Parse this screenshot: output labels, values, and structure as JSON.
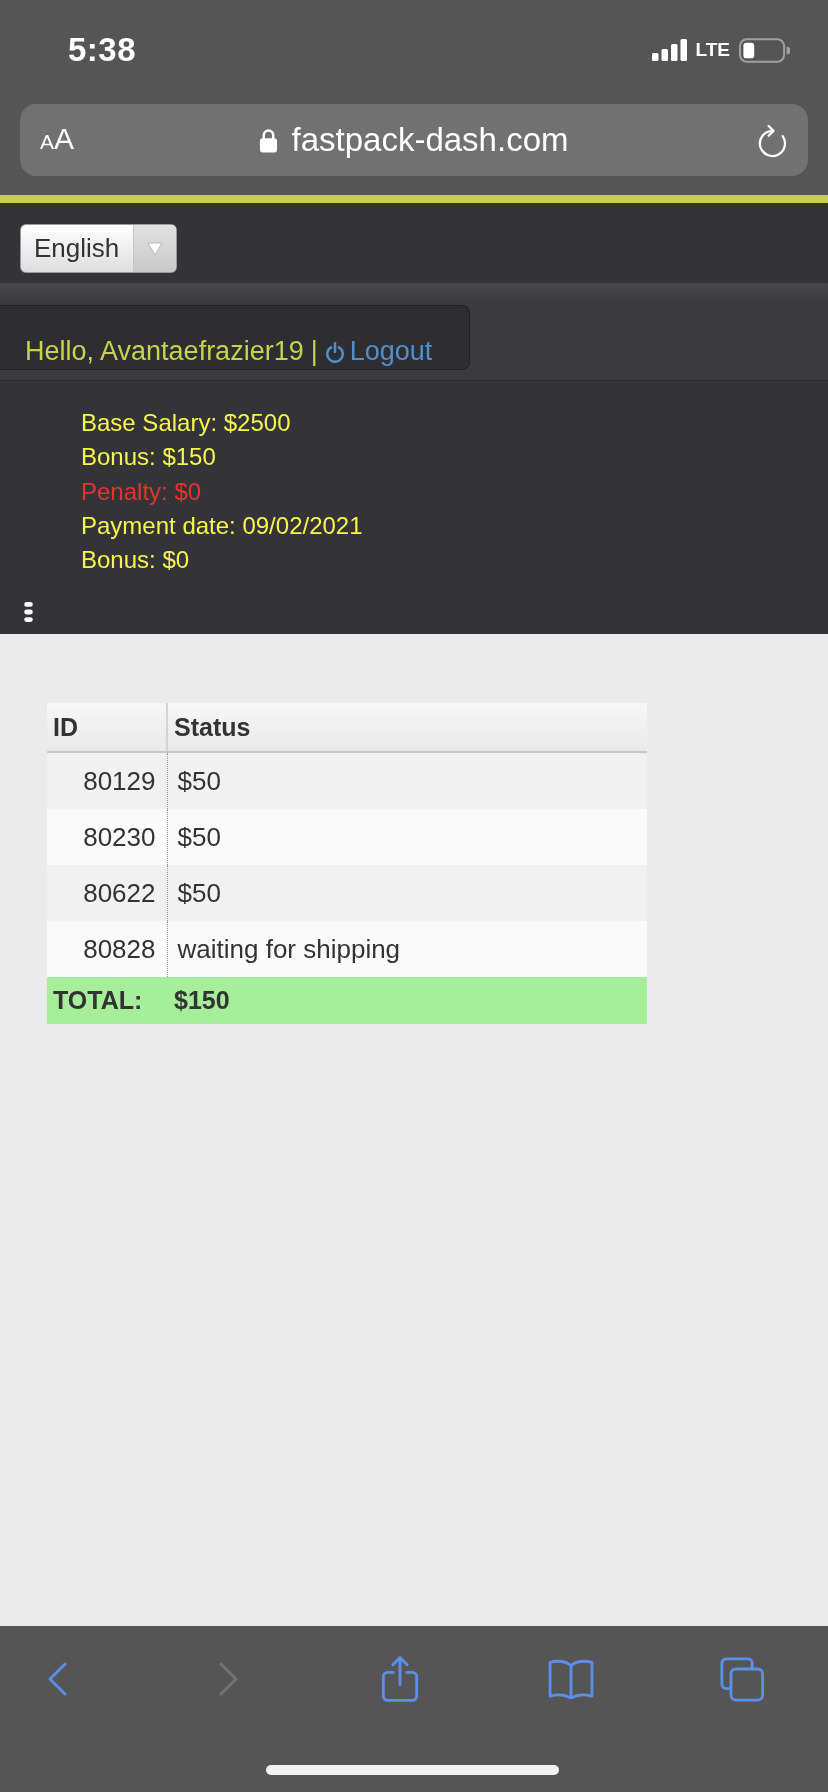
{
  "status_bar": {
    "time": "5:38",
    "network": "LTE"
  },
  "address_bar": {
    "reader_button": "AA",
    "url": "fastpack-dash.com",
    "secure": true
  },
  "language_select": {
    "value": "English"
  },
  "user_bar": {
    "greeting": "Hello, Avantaefrazier19",
    "separator": "|",
    "logout": "Logout"
  },
  "summary": [
    {
      "text": "Base Salary: $2500",
      "color": "#f5f54a"
    },
    {
      "text": "Bonus: $150",
      "color": "#f5f54a"
    },
    {
      "text": "Penalty: $0",
      "color": "#e2362b"
    },
    {
      "text": "Payment date: 09/02/2021",
      "color": "#f5f54a"
    },
    {
      "text": "Bonus: $0",
      "color": "#f5f54a"
    }
  ],
  "table": {
    "columns": [
      "ID",
      "Status"
    ],
    "rows": [
      {
        "id": "80129",
        "status": "$50"
      },
      {
        "id": "80230",
        "status": "$50"
      },
      {
        "id": "80622",
        "status": "$50"
      },
      {
        "id": "80828",
        "status": "waiting for shipping"
      }
    ],
    "total": {
      "label": "TOTAL:",
      "value": "$150"
    }
  },
  "toolbar": [
    {
      "kind": "back",
      "disabled": false
    },
    {
      "kind": "forward",
      "disabled": true
    },
    {
      "kind": "share",
      "disabled": false
    },
    {
      "kind": "bookmarks",
      "disabled": false
    },
    {
      "kind": "tabs",
      "disabled": false
    }
  ]
}
